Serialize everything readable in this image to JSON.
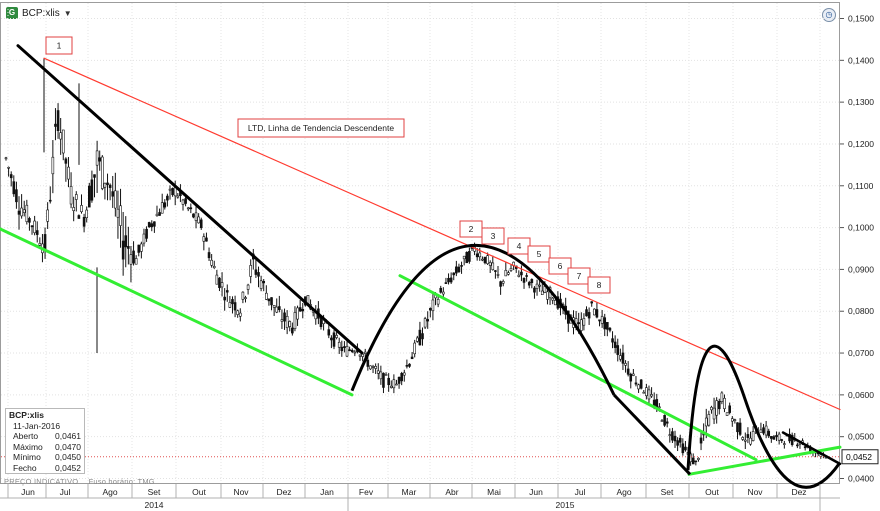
{
  "window": {
    "symbol_title": "BCP:xlis",
    "app_icon": "chart-app-icon",
    "caret": "▼"
  },
  "chart_data": {
    "type": "line",
    "chart_style": "candlestick",
    "symbol": "BCP:xlis",
    "yaxis": {
      "ticks": [
        "0,1500",
        "0,1400",
        "0,1300",
        "0,1200",
        "0,1100",
        "0,1000",
        "0,0900",
        "0,0800",
        "0,0700",
        "0,0600",
        "0,0500",
        "0,0400"
      ],
      "ylim": [
        0.04,
        0.15
      ],
      "position": "right"
    },
    "xaxis": {
      "month_ticks": [
        "Jun",
        "Jul",
        "Ago",
        "Set",
        "Out",
        "Nov",
        "Dez",
        "Jan",
        "Fev",
        "Mar",
        "Abr",
        "Mai",
        "Jun",
        "Jul",
        "Ago",
        "Set",
        "Out",
        "Nov",
        "Dez"
      ],
      "year_labels": [
        "2014",
        "2015"
      ]
    },
    "grid": true,
    "last_price": {
      "value": 0.0452,
      "label": "0,0452"
    },
    "series": [
      {
        "kind": "ohlc_path",
        "points": [
          [
            0.115,
            0.121,
            0.112,
            0.118
          ],
          [
            0.108,
            0.116,
            0.098,
            0.104
          ],
          [
            0.1,
            0.106,
            0.095,
            0.102
          ],
          [
            0.097,
            0.101,
            0.083,
            0.094
          ],
          [
            0.125,
            0.141,
            0.115,
            0.13
          ],
          [
            0.11,
            0.118,
            0.1,
            0.106
          ],
          [
            0.104,
            0.11,
            0.096,
            0.101
          ],
          [
            0.107,
            0.134,
            0.1,
            0.124
          ],
          [
            0.112,
            0.12,
            0.104,
            0.108
          ],
          [
            0.098,
            0.104,
            0.07,
            0.097
          ],
          [
            0.094,
            0.1,
            0.088,
            0.091
          ],
          [
            0.099,
            0.103,
            0.094,
            0.101
          ],
          [
            0.103,
            0.11,
            0.098,
            0.107
          ],
          [
            0.11,
            0.115,
            0.104,
            0.108
          ],
          [
            0.104,
            0.109,
            0.1,
            0.105
          ],
          [
            0.1,
            0.106,
            0.096,
            0.101
          ],
          [
            0.092,
            0.099,
            0.086,
            0.088
          ],
          [
            0.085,
            0.091,
            0.079,
            0.082
          ],
          [
            0.082,
            0.088,
            0.077,
            0.079
          ],
          [
            0.09,
            0.1,
            0.084,
            0.093
          ],
          [
            0.086,
            0.092,
            0.08,
            0.083
          ],
          [
            0.081,
            0.087,
            0.074,
            0.077
          ],
          [
            0.078,
            0.084,
            0.072,
            0.075
          ],
          [
            0.082,
            0.087,
            0.078,
            0.084
          ],
          [
            0.08,
            0.085,
            0.075,
            0.078
          ],
          [
            0.075,
            0.081,
            0.071,
            0.073
          ],
          [
            0.071,
            0.076,
            0.067,
            0.07
          ],
          [
            0.07,
            0.075,
            0.066,
            0.073
          ],
          [
            0.068,
            0.073,
            0.064,
            0.066
          ],
          [
            0.064,
            0.07,
            0.06,
            0.063
          ],
          [
            0.062,
            0.066,
            0.059,
            0.063
          ],
          [
            0.066,
            0.072,
            0.063,
            0.07
          ],
          [
            0.072,
            0.08,
            0.068,
            0.078
          ],
          [
            0.08,
            0.087,
            0.076,
            0.085
          ],
          [
            0.086,
            0.09,
            0.083,
            0.088
          ],
          [
            0.089,
            0.095,
            0.086,
            0.093
          ],
          [
            0.094,
            0.099,
            0.09,
            0.096
          ],
          [
            0.093,
            0.097,
            0.089,
            0.091
          ],
          [
            0.086,
            0.093,
            0.082,
            0.088
          ],
          [
            0.09,
            0.094,
            0.086,
            0.091
          ],
          [
            0.088,
            0.092,
            0.084,
            0.087
          ],
          [
            0.086,
            0.091,
            0.082,
            0.084
          ],
          [
            0.083,
            0.088,
            0.079,
            0.085
          ],
          [
            0.081,
            0.086,
            0.076,
            0.078
          ],
          [
            0.075,
            0.082,
            0.07,
            0.077
          ],
          [
            0.08,
            0.085,
            0.076,
            0.082
          ],
          [
            0.078,
            0.083,
            0.074,
            0.076
          ],
          [
            0.072,
            0.078,
            0.068,
            0.07
          ],
          [
            0.066,
            0.072,
            0.062,
            0.064
          ],
          [
            0.062,
            0.066,
            0.058,
            0.061
          ],
          [
            0.058,
            0.064,
            0.055,
            0.057
          ],
          [
            0.052,
            0.058,
            0.049,
            0.051
          ],
          [
            0.048,
            0.053,
            0.045,
            0.047
          ],
          [
            0.043,
            0.048,
            0.041,
            0.044
          ],
          [
            0.05,
            0.062,
            0.046,
            0.059
          ],
          [
            0.06,
            0.065,
            0.055,
            0.058
          ],
          [
            0.055,
            0.06,
            0.05,
            0.052
          ],
          [
            0.05,
            0.055,
            0.046,
            0.048
          ],
          [
            0.052,
            0.057,
            0.048,
            0.053
          ],
          [
            0.05,
            0.054,
            0.047,
            0.049
          ],
          [
            0.049,
            0.053,
            0.046,
            0.05
          ],
          [
            0.05,
            0.054,
            0.047,
            0.048
          ],
          [
            0.047,
            0.05,
            0.045,
            0.046
          ],
          [
            0.046,
            0.048,
            0.044,
            0.0452
          ]
        ]
      }
    ],
    "trendlines": [
      {
        "name": "LTD, Linha de Tendencia Descendente",
        "color": "#ff3b30",
        "from": [
          "Jul-2014",
          0.1405
        ],
        "to": [
          "Jan-2016",
          0.0565
        ]
      },
      {
        "color": "#000000",
        "from": [
          "Jun-2014",
          0.1435
        ],
        "to": [
          "Jan-2015",
          0.07
        ]
      },
      {
        "color": "#33ee33",
        "from": [
          "Jun-2014",
          0.0997
        ],
        "to": [
          "Jan-2015",
          0.06
        ]
      },
      {
        "color": "#33ee33",
        "from": [
          "Mar-2015",
          0.0885
        ],
        "to": [
          "Nov-2015",
          0.0445
        ]
      },
      {
        "color": "#33ee33",
        "from": [
          "Set-2015",
          0.041
        ],
        "to": [
          "Jan-2016",
          0.0475
        ]
      },
      {
        "color": "#000000",
        "from": [
          "Dez-2015",
          0.051
        ],
        "to": [
          "Jan-2016",
          0.0435
        ]
      }
    ],
    "arcs": [
      {
        "color": "#000000",
        "peak": 0.0955
      },
      {
        "color": "#000000",
        "peak": 0.066
      }
    ],
    "annotations": [
      "1",
      "2",
      "3",
      "4",
      "5",
      "6",
      "7",
      "8",
      "LTD, Linha de Tendencia Descendente"
    ]
  },
  "info_panel": {
    "symbol": "BCP:xlis",
    "date": "11-Jan-2016",
    "rows": [
      {
        "label": "Aberto",
        "value": "0,0461"
      },
      {
        "label": "Máximo",
        "value": "0,0470"
      },
      {
        "label": "Mínimo",
        "value": "0,0450"
      },
      {
        "label": "Fecho",
        "value": "0,0452"
      }
    ]
  },
  "footnote": {
    "indicator": "PREÇO INDICATIVO",
    "timezone": "Fuso horário: TMG"
  },
  "colors": {
    "candle_up": "#ffffff",
    "candle_down": "#111111",
    "resistance": "#ff3b30",
    "support": "#33ee33",
    "trend": "#000000"
  }
}
